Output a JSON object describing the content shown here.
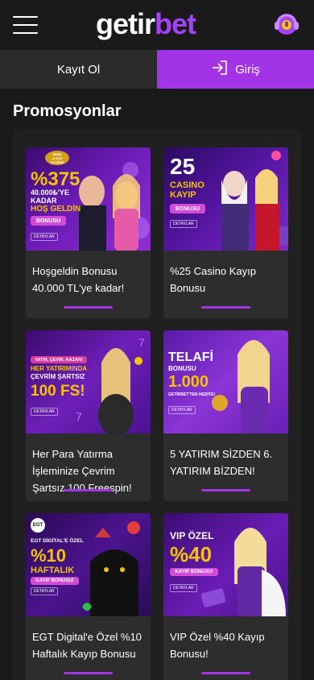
{
  "header": {
    "logo_part1": "getir",
    "logo_part2": "bet",
    "menu_icon": "hamburger-menu-icon",
    "support_icon": "headset-support-icon"
  },
  "auth": {
    "register_label": "Kayıt Ol",
    "login_label": "Giriş",
    "login_icon": "login-arrow-icon"
  },
  "page": {
    "title": "Promosyonlar"
  },
  "colors": {
    "accent": "#a233e6",
    "background": "#1a1a1a",
    "card": "#2d2d2d"
  },
  "promotions": [
    {
      "title": "Hoşgeldin Bonusu 40.000 TL'ye kadar!",
      "banner": {
        "line1": "%375",
        "line2": "40.000₺'YE",
        "line3": "KADAR",
        "line4": "HOŞ GELDİN",
        "pill": "BONUSU",
        "badge_top": "ŞİMDİ",
        "badge_mid": "10 KAT",
        "badge_bot": "ÇEVRİM!",
        "button": "DETAYLAR"
      }
    },
    {
      "title": "%25 Casino Kayıp Bonusu",
      "banner": {
        "line1": "25",
        "line2": "CASINO",
        "line3": "KAYIP",
        "pill": "BONUSU",
        "button": "DETAYLAR"
      }
    },
    {
      "title": "Her Para Yatırma İşleminize Çevrim Şartsız 100 Freespin!",
      "banner": {
        "line1": "YATIR, ÇEVİR, KAZAN!",
        "line2": "HER YATIRIMINDA",
        "line3": "ÇEVRİM ŞARTSIZ",
        "line4": "100 FS!",
        "button": "DETAYLAR"
      }
    },
    {
      "title": "5 YATIRIM SİZDEN 6. YATIRIM BİZDEN!",
      "banner": {
        "line1": "TELAFİ",
        "line2": "BONUSU",
        "line3": "1.000",
        "line4": "GETİRBET'TEN HEDİYE!",
        "button": "DETAYLAR"
      }
    },
    {
      "title": "EGT Digital'e Özel %10 Haftalık Kayıp Bonusu",
      "banner": {
        "logo": "EGT",
        "line1": "EGT DİGİTAL'E ÖZEL",
        "line2": "%10",
        "line3": "HAFTALIK",
        "pill": "KAYIP BONUSU!",
        "button": "DETAYLAR"
      }
    },
    {
      "title": "VIP Özel %40 Kayıp Bonusu!",
      "banner": {
        "line1": "VIP ÖZEL",
        "line2": "%40",
        "pill": "KAYIP BONUSU!",
        "button": "DETAYLAR"
      }
    }
  ]
}
